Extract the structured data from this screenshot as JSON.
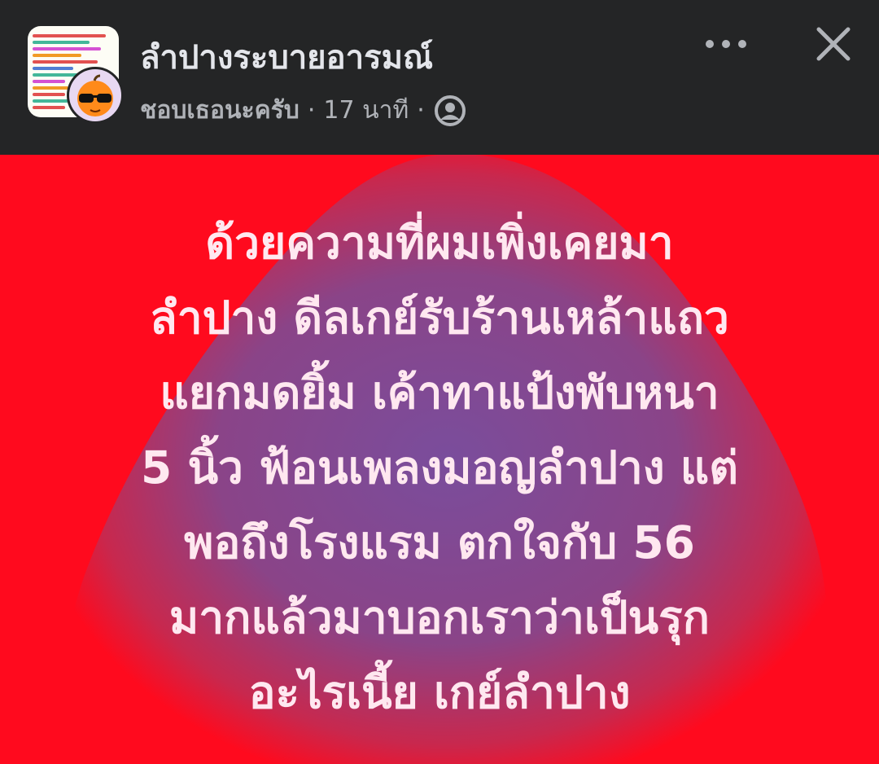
{
  "header": {
    "group_name": "ลำปางระบายอารมณ์",
    "author": "ชอบเธอนะครับ",
    "sep1": "·",
    "time": "17 นาที",
    "sep2": "·"
  },
  "icons": {
    "more": "more-horizontal-icon",
    "close": "close-icon",
    "privacy": "anonymous-member-icon"
  },
  "colors": {
    "header_bg": "#242526",
    "post_bg": "#ff0a1e",
    "blob": "#7a4d9c",
    "text": "#ffe8f0"
  },
  "post": {
    "lines": [
      "ด้วยความที่ผมเพิ่งเคยมา",
      "ลำปาง ดีลเกย์รับร้านเหล้าแถว",
      "แยกมดยิ้ม เค้าทาแป้งพับหนา",
      "5 นิ้ว ฟ้อนเพลงมอญลำปาง แต่",
      "พอถึงโรงแรม ตกใจกับ 56",
      "มากแล้วมาบอกเราว่าเป็นรุก",
      "อะไรเนี้ย เกย์ลำปาง"
    ]
  }
}
